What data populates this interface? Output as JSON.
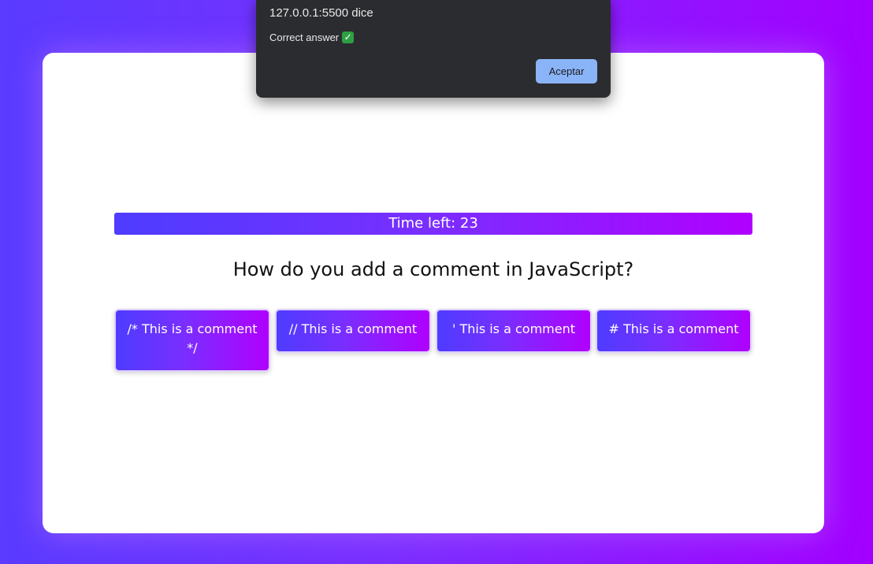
{
  "quiz": {
    "timer_text": "Time left: 23",
    "question": "How do you add a comment in JavaScript?",
    "answers": [
      {
        "label": "/* This is a comment */"
      },
      {
        "label": "// This is a comment"
      },
      {
        "label": "' This is a comment"
      },
      {
        "label": "# This is a comment"
      }
    ]
  },
  "alert": {
    "title": "127.0.0.1:5500 dice",
    "message": "Correct answer",
    "message_icon": "check-mark-icon",
    "button_label": "Aceptar"
  },
  "colors": {
    "gradient_start": "#4e3cff",
    "gradient_end": "#b000ff",
    "dialog_bg": "#2b2c30",
    "dialog_button": "#8ab4f8",
    "check_green": "#2ea043"
  }
}
